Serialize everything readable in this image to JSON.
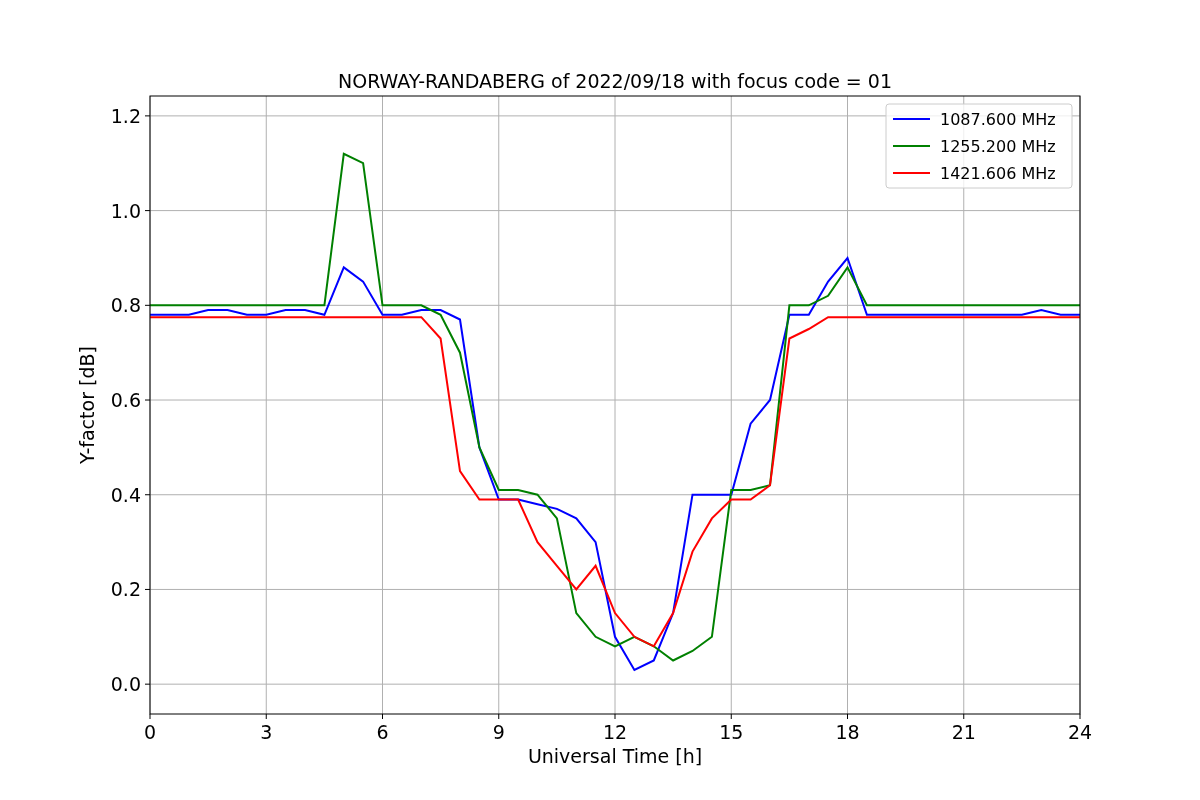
{
  "figure": {
    "chart_data": {
      "type": "line",
      "title": "NORWAY-RANDABERG of 2022/09/18 with focus code = 01",
      "xlabel": "Universal Time [h]",
      "ylabel": "Y-factor [dB]",
      "x": [
        0,
        0.5,
        1,
        1.5,
        2,
        2.5,
        3,
        3.5,
        4,
        4.5,
        5,
        5.5,
        6,
        6.5,
        7,
        7.5,
        8,
        8.5,
        9,
        9.5,
        10,
        10.5,
        11,
        11.5,
        12,
        12.5,
        13,
        13.5,
        14,
        14.5,
        15,
        15.5,
        16,
        16.5,
        17,
        17.5,
        18,
        18.5,
        19,
        19.5,
        20,
        20.5,
        21,
        21.5,
        22,
        22.5,
        23,
        23.5,
        24
      ],
      "series": [
        {
          "name": "1087.600 MHz",
          "color": "#0000ff",
          "values": [
            0.78,
            0.78,
            0.78,
            0.79,
            0.79,
            0.78,
            0.78,
            0.79,
            0.79,
            0.78,
            0.88,
            0.85,
            0.78,
            0.78,
            0.79,
            0.79,
            0.77,
            0.5,
            0.39,
            0.39,
            0.38,
            0.37,
            0.35,
            0.3,
            0.1,
            0.03,
            0.05,
            0.15,
            0.4,
            0.4,
            0.4,
            0.55,
            0.6,
            0.78,
            0.78,
            0.85,
            0.9,
            0.78,
            0.78,
            0.78,
            0.78,
            0.78,
            0.78,
            0.78,
            0.78,
            0.78,
            0.79,
            0.78,
            0.78
          ]
        },
        {
          "name": "1255.200 MHz",
          "color": "#008000",
          "values": [
            0.8,
            0.8,
            0.8,
            0.8,
            0.8,
            0.8,
            0.8,
            0.8,
            0.8,
            0.8,
            1.12,
            1.1,
            0.8,
            0.8,
            0.8,
            0.78,
            0.7,
            0.5,
            0.41,
            0.41,
            0.4,
            0.35,
            0.15,
            0.1,
            0.08,
            0.1,
            0.08,
            0.05,
            0.07,
            0.1,
            0.41,
            0.41,
            0.42,
            0.8,
            0.8,
            0.82,
            0.88,
            0.8,
            0.8,
            0.8,
            0.8,
            0.8,
            0.8,
            0.8,
            0.8,
            0.8,
            0.8,
            0.8,
            0.8
          ]
        },
        {
          "name": "1421.606 MHz",
          "color": "#ff0000",
          "values": [
            0.775,
            0.775,
            0.775,
            0.775,
            0.775,
            0.775,
            0.775,
            0.775,
            0.775,
            0.775,
            0.775,
            0.775,
            0.775,
            0.775,
            0.775,
            0.73,
            0.45,
            0.39,
            0.39,
            0.39,
            0.3,
            0.25,
            0.2,
            0.25,
            0.15,
            0.1,
            0.08,
            0.15,
            0.28,
            0.35,
            0.39,
            0.39,
            0.42,
            0.73,
            0.75,
            0.775,
            0.775,
            0.775,
            0.775,
            0.775,
            0.775,
            0.775,
            0.775,
            0.775,
            0.775,
            0.775,
            0.775,
            0.775,
            0.775
          ]
        }
      ],
      "grid": true,
      "legend": true,
      "xlim": [
        0,
        24
      ],
      "ylim": [
        -0.063,
        1.242
      ],
      "xticks": [
        0,
        3,
        6,
        9,
        12,
        15,
        18,
        21,
        24
      ],
      "yticks": [
        {
          "value": 0,
          "label": "0.0"
        },
        {
          "value": 0.2,
          "label": "0.2"
        },
        {
          "value": 0.4,
          "label": "0.4"
        },
        {
          "value": 0.6,
          "label": "0.6"
        },
        {
          "value": 0.8,
          "label": "0.8"
        },
        {
          "value": 1,
          "label": "1.0"
        },
        {
          "value": 1.2,
          "label": "1.2"
        }
      ]
    }
  }
}
